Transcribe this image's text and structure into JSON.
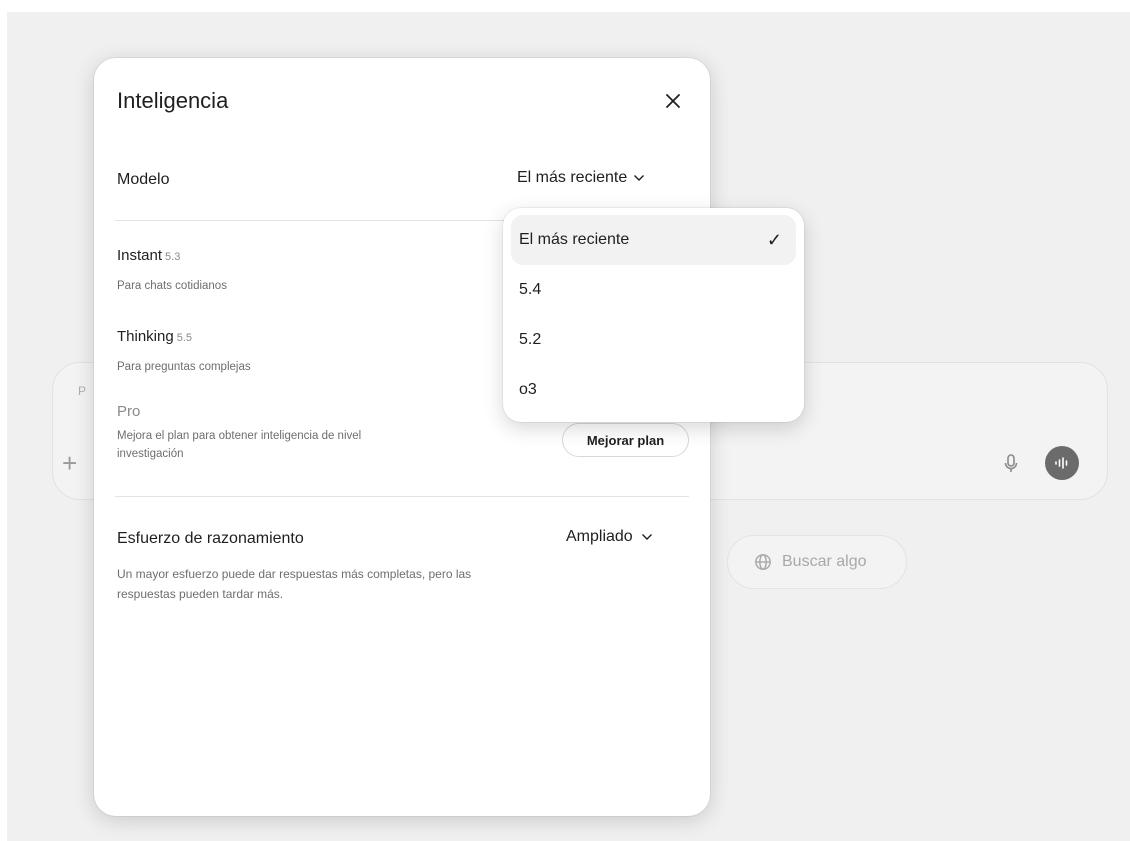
{
  "background": {
    "composer_placeholder_fragment": "P",
    "plus_label": "+",
    "search_chip_label": "Buscar algo"
  },
  "panel": {
    "title": "Inteligencia",
    "model_label": "Modelo",
    "model_value": "El más reciente",
    "options": [
      {
        "name": "Instant",
        "version": "5.3",
        "description": "Para chats cotidianos"
      },
      {
        "name": "Thinking",
        "version": "5.5",
        "description": "Para preguntas complejas"
      },
      {
        "name": "Pro",
        "version": "",
        "description_line1": "Mejora el plan para obtener inteligencia de nivel",
        "description_line2": "investigación"
      }
    ],
    "upgrade_label": "Mejorar plan",
    "effort_label": "Esfuerzo de razonamiento",
    "effort_value": "Ampliado",
    "effort_desc_line1": "Un mayor esfuerzo puede dar respuestas más completas, pero las",
    "effort_desc_line2": "respuestas pueden tardar más."
  },
  "dropdown": {
    "items": [
      {
        "label": "El más reciente",
        "selected": true
      },
      {
        "label": "5.4",
        "selected": false
      },
      {
        "label": "5.2",
        "selected": false
      },
      {
        "label": "o3",
        "selected": false
      }
    ],
    "check_glyph": "✓"
  },
  "colors": {
    "text": "#1f1f1f",
    "muted": "#6e6e6e",
    "backdrop": "#f0f0f0",
    "selected_bg": "#f2f2f2"
  }
}
